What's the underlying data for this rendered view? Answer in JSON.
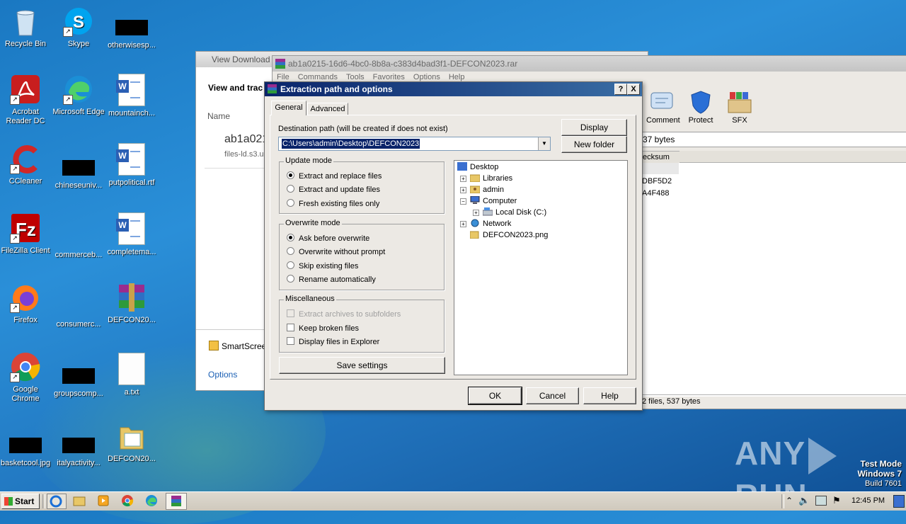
{
  "desktop": {
    "icons": [
      {
        "label": "Recycle Bin"
      },
      {
        "label": "Skype"
      },
      {
        "label": "otherwisesp..."
      },
      {
        "label": "Acrobat Reader DC"
      },
      {
        "label": "Microsoft Edge"
      },
      {
        "label": "mountainch..."
      },
      {
        "label": "CCleaner"
      },
      {
        "label": "chineseuniv..."
      },
      {
        "label": "putpolitical.rtf"
      },
      {
        "label": "FileZilla Client"
      },
      {
        "label": "commerceb..."
      },
      {
        "label": "completema..."
      },
      {
        "label": "Firefox"
      },
      {
        "label": "consumerc..."
      },
      {
        "label": "DEFCON20..."
      },
      {
        "label": "Google Chrome"
      },
      {
        "label": "groupscomp..."
      },
      {
        "label": "a.txt"
      },
      {
        "label": "basketcool.jpg"
      },
      {
        "label": "italyactivity..."
      },
      {
        "label": "DEFCON20..."
      }
    ]
  },
  "downloads_window": {
    "title": "View Download",
    "heading": "View and trac",
    "col_name": "Name",
    "file_name": "ab1a021",
    "file_source": "files-ld.s3.u",
    "smartscreen": "SmartScree",
    "options": "Options"
  },
  "winrar": {
    "title": "ab1a0215-16d6-4bc0-8b8a-c383d4bad3f1-DEFCON2023.rar",
    "menu": [
      "File",
      "Commands",
      "Tools",
      "Favorites",
      "Options",
      "Help"
    ],
    "toolbar": [
      {
        "label": "Comment"
      },
      {
        "label": "Protect"
      },
      {
        "label": "SFX"
      }
    ],
    "size_text": "37 bytes",
    "col_checksum": "ecksum",
    "rows": [
      "DBF5D2",
      "A4F488"
    ],
    "status": "2 files, 537 bytes"
  },
  "dialog": {
    "title": "Extraction path and options",
    "help_btn": "?",
    "close_btn": "X",
    "tabs": [
      "General",
      "Advanced"
    ],
    "dest_label": "Destination path (will be created if does not exist)",
    "dest_value": "C:\\Users\\admin\\Desktop\\DEFCON2023",
    "display_btn": "Display",
    "new_folder_btn": "New folder",
    "update_mode": {
      "title": "Update mode",
      "options": [
        "Extract and replace files",
        "Extract and update files",
        "Fresh existing files only"
      ],
      "selected": 0
    },
    "overwrite_mode": {
      "title": "Overwrite mode",
      "options": [
        "Ask before overwrite",
        "Overwrite without prompt",
        "Skip existing files",
        "Rename automatically"
      ],
      "selected": 0
    },
    "misc": {
      "title": "Miscellaneous",
      "options": [
        "Extract archives to subfolders",
        "Keep broken files",
        "Display files in Explorer"
      ]
    },
    "save_settings": "Save settings",
    "tree": [
      "Desktop",
      "Libraries",
      "admin",
      "Computer",
      "Local Disk (C:)",
      "Network",
      "DEFCON2023.png"
    ],
    "ok": "OK",
    "cancel": "Cancel",
    "help": "Help"
  },
  "watermark": {
    "brand_left": "ANY",
    "brand_right": "RUN"
  },
  "os": {
    "line1": "Test Mode",
    "line2": "Windows 7",
    "line3": "Build 7601"
  },
  "taskbar": {
    "start": "Start",
    "time": "12:45 PM"
  }
}
